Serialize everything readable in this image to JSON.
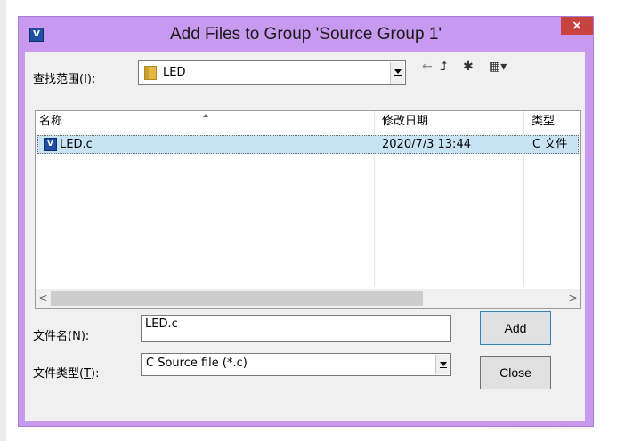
{
  "window": {
    "title": "Add Files to Group 'Source Group 1'",
    "close_glyph": "×",
    "app_icon": "uvision-icon"
  },
  "lookin": {
    "label_pre": "查找范围(",
    "label_key": "I",
    "label_post": "):",
    "value": "LED"
  },
  "toolbar": {
    "back_glyph": "←",
    "up_glyph": "⮥",
    "newfolder_glyph": "✱",
    "view_glyph": "▦▾"
  },
  "list": {
    "columns": [
      "名称",
      "修改日期",
      "类型"
    ],
    "rows": [
      {
        "name": "LED.c",
        "date": "2020/7/3 13:44",
        "type": "C 文件"
      }
    ]
  },
  "scroll": {
    "left_glyph": "<",
    "right_glyph": ">"
  },
  "filename": {
    "label_pre": "文件名(",
    "label_key": "N",
    "label_post": "):",
    "value": "LED.c"
  },
  "filetype": {
    "label_pre": "文件类型(",
    "label_key": "T",
    "label_post": "):",
    "value": "C Source file (*.c)"
  },
  "buttons": {
    "add": "Add",
    "close": "Close"
  },
  "colors": {
    "titlebar": "#c799ef",
    "close": "#c84340",
    "selection": "#c8e4f4"
  }
}
